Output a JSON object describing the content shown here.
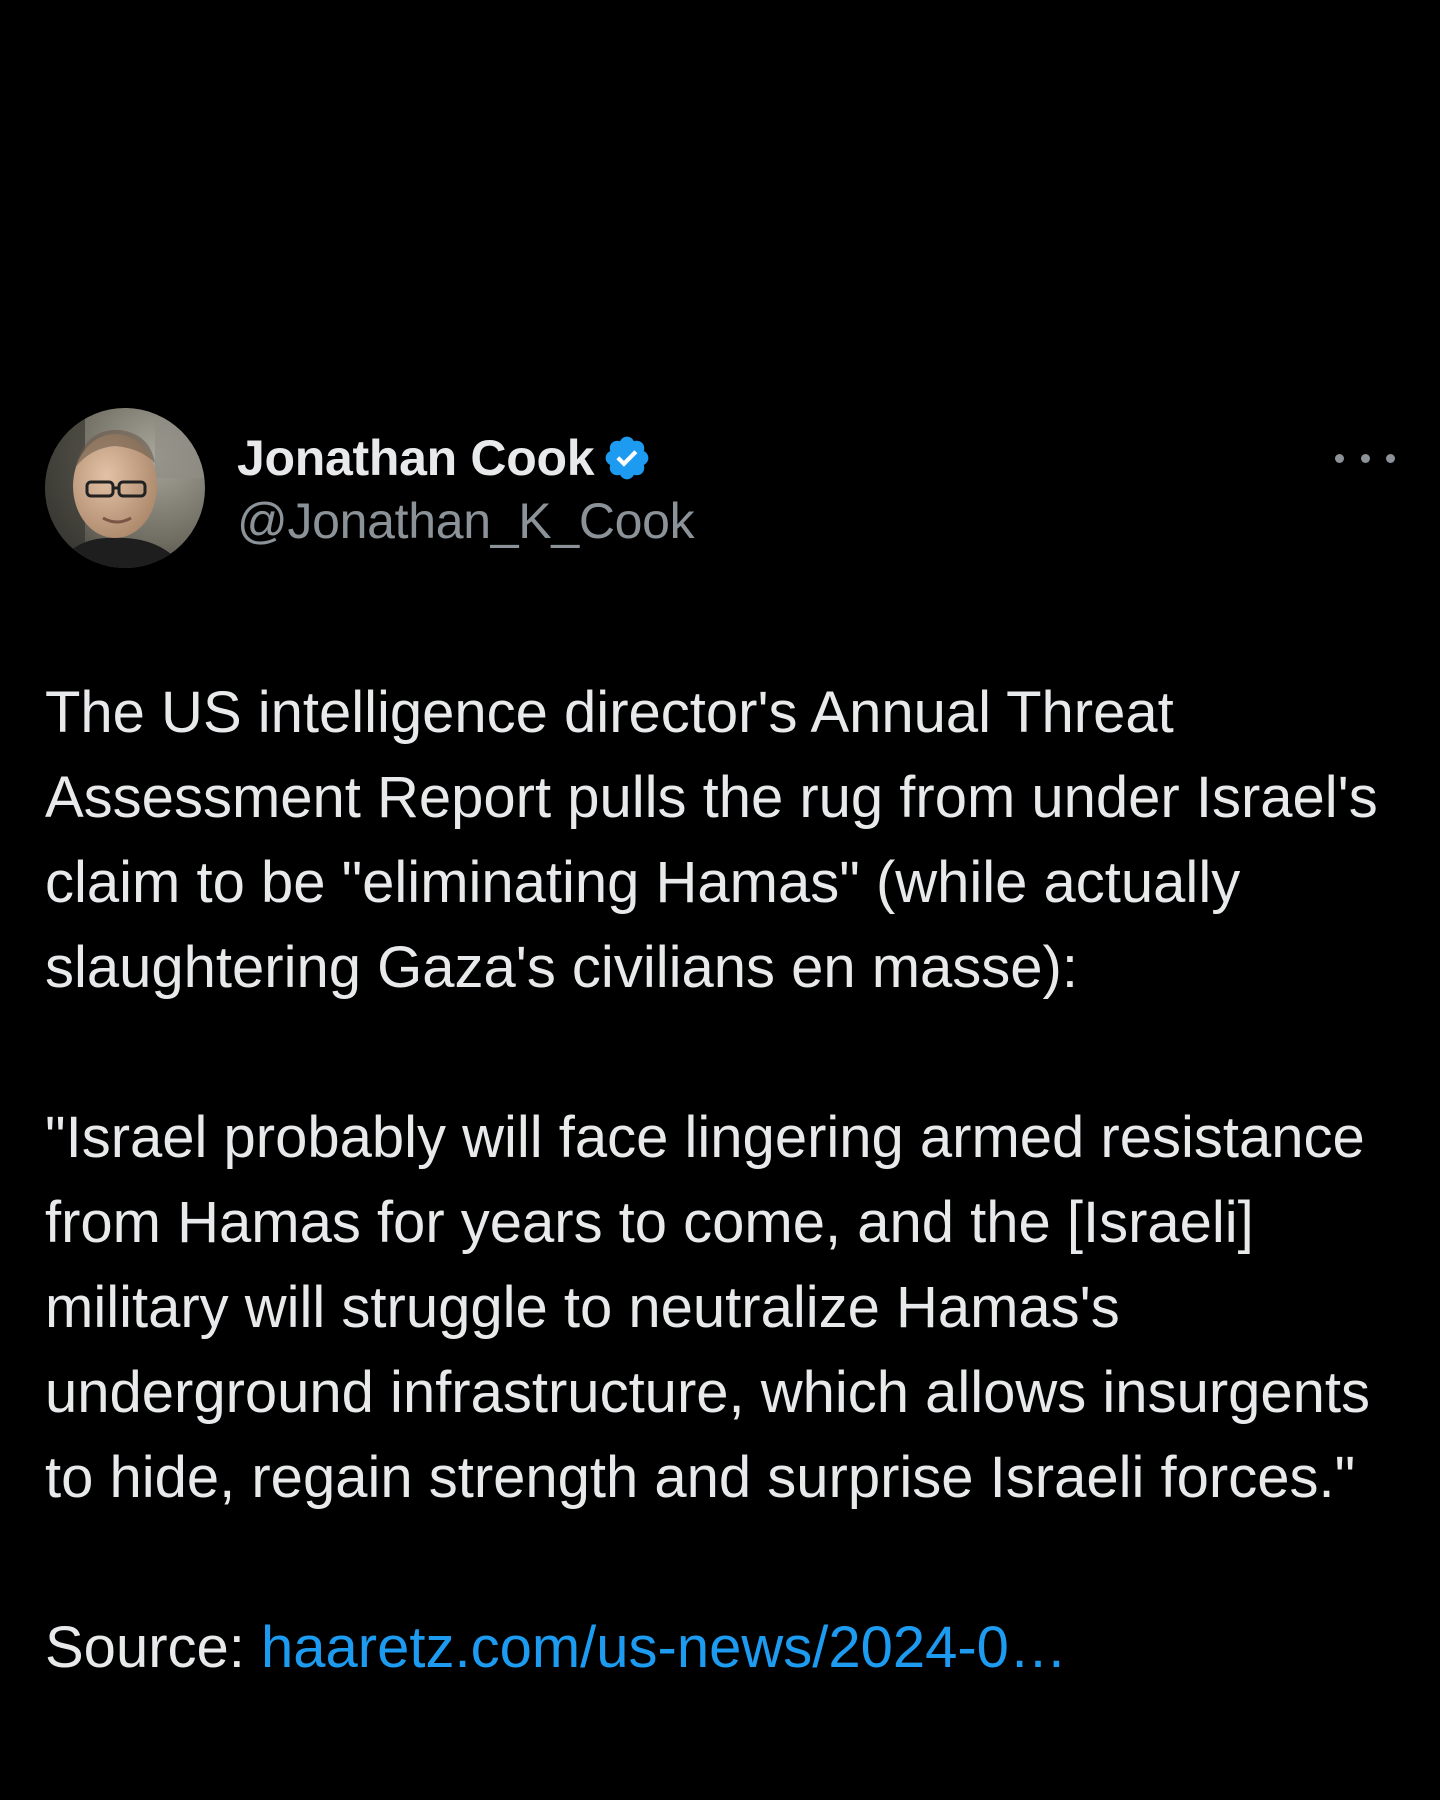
{
  "tweet": {
    "author": {
      "name": "Jonathan Cook",
      "handle": "@Jonathan_K_Cook",
      "verified_icon": "verified-badge-icon",
      "avatar_icon": "avatar-photo"
    },
    "more_icon": "more-options-icon",
    "body": {
      "paragraph_1": "The US intelligence director's Annual Threat Assessment Report pulls the rug from under Israel's claim to be \"eliminating Hamas\" (while actually slaughtering Gaza's civilians en masse):",
      "paragraph_2": "\"Israel probably will face lingering armed resistance from Hamas for years to come, and the [Israeli] military will struggle to neutralize Hamas's underground infrastructure, which allows insurgents to hide, regain strength and surprise Israeli forces.\"",
      "source_label": "Source: ",
      "source_link": "haaretz.com/us-news/2024-0…"
    }
  },
  "colors": {
    "background": "#000000",
    "primary_text": "#e7e9ea",
    "secondary_text": "#8b9298",
    "link": "#1d9bf0",
    "verified": "#1d9bf0"
  }
}
